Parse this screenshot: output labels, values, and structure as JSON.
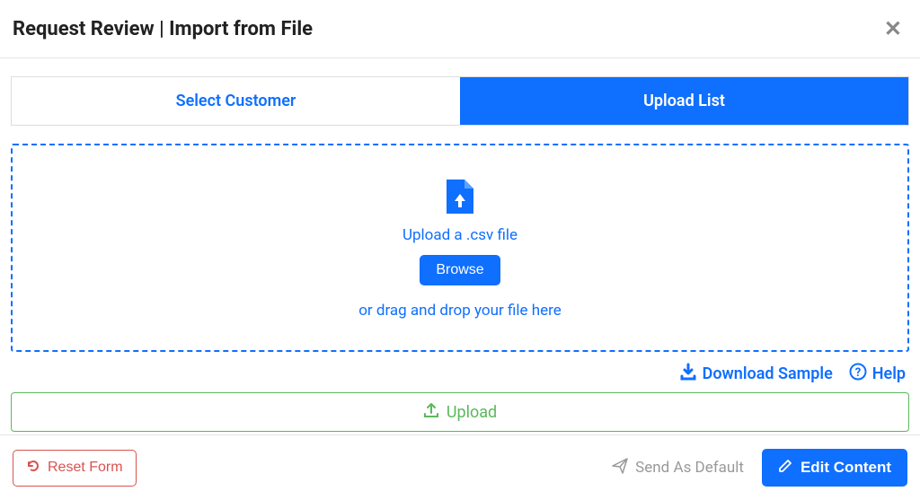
{
  "header": {
    "title": "Request Review | Import from File"
  },
  "tabs": {
    "select_customer": "Select Customer",
    "upload_list": "Upload List"
  },
  "dropzone": {
    "upload_text": "Upload a .csv file",
    "browse_label": "Browse",
    "dragdrop_text": "or drag and drop your file here"
  },
  "helpers": {
    "download_sample": "Download Sample",
    "help": "Help"
  },
  "upload_bar": {
    "label": "Upload"
  },
  "footer": {
    "reset_label": "Reset Form",
    "send_default_label": "Send As Default",
    "edit_content_label": "Edit Content"
  }
}
